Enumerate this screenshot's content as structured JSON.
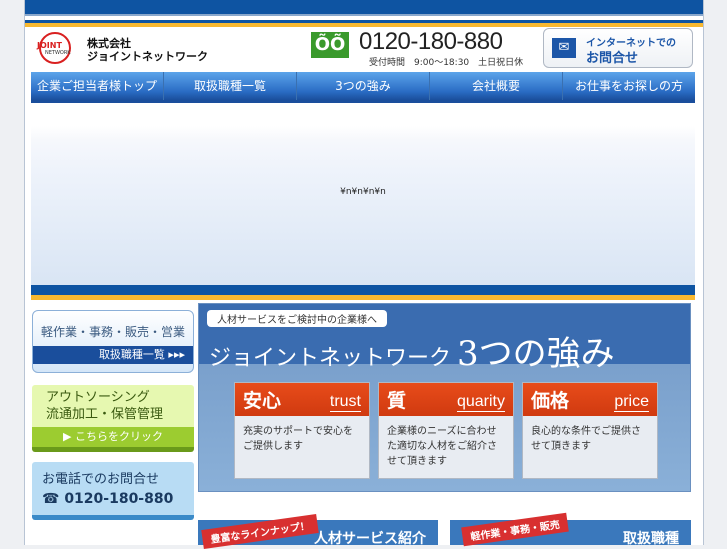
{
  "header": {
    "logo_text": "JOINT NETWORK",
    "company_line1": "株式会社",
    "company_line2": "ジョイントネットワーク",
    "freedial_icon": "freedial-icon",
    "phone": "0120-180-880",
    "hours": "受付時間　9:00〜18:30　土日祝日休",
    "contact_line1": "インターネットでの",
    "contact_line2": "お問合せ"
  },
  "nav": [
    "企業ご担当者様トップ",
    "取扱職種一覧",
    "3つの強み",
    "会社概要",
    "お仕事をお探しの方"
  ],
  "hero": {
    "text": "¥n¥n¥n¥n"
  },
  "sidebar": {
    "jobs": {
      "title": "軽作業・事務・販売・営業",
      "link": "取扱職種一覧 ▸▸▸"
    },
    "outsourcing": {
      "line1": "アウトソーシング",
      "line2": "流通加工・保管管理",
      "link": "▶ こちらをクリック"
    },
    "phone": {
      "title": "お電話でのお問合せ",
      "number": "☎ 0120-180-880"
    }
  },
  "strengths": {
    "pill": "人材サービスをご検討中の企業様へ",
    "title": "ジョイントネットワーク",
    "title_big": "3つの強み",
    "cards": [
      {
        "jp": "安心",
        "en": "trust",
        "text": "充実のサポートで安心をご提供します"
      },
      {
        "jp": "質",
        "en": "quarity",
        "text": "企業様のニーズに合わせた適切な人材をご紹介させて頂きます"
      },
      {
        "jp": "価格",
        "en": "price",
        "text": "良心的な条件でご提供させて頂きます"
      }
    ]
  },
  "bottom": [
    {
      "ribbon": "豊富なラインナップ！",
      "title": "人材サービス紹介"
    },
    {
      "ribbon": "軽作業・事務・販売",
      "title": "取扱職種"
    }
  ]
}
